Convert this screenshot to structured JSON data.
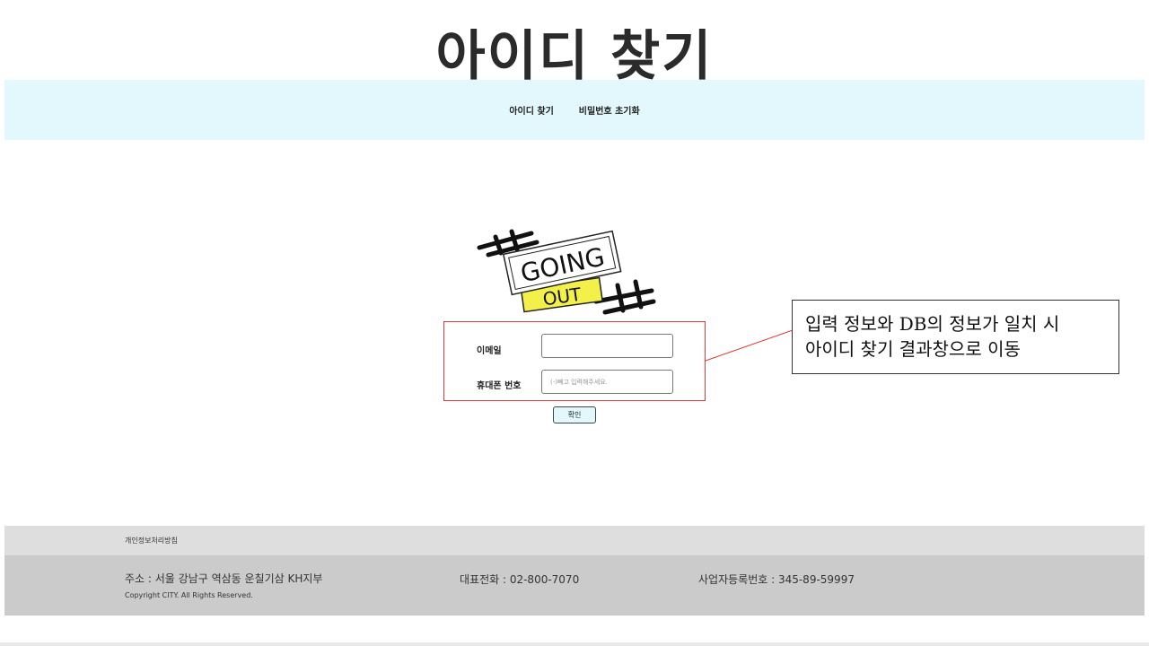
{
  "page": {
    "title": "아이디 찾기"
  },
  "nav": {
    "items": [
      {
        "label": "아이디 찾기"
      },
      {
        "label": "비밀번호 초기화"
      }
    ]
  },
  "logo": {
    "line1": "GOING",
    "line2": "OUT"
  },
  "form": {
    "email_label": "이메일",
    "email_value": "",
    "phone_label": "휴대폰 번호",
    "phone_placeholder": "(-)빼고 입력해주세요.",
    "confirm_label": "확인"
  },
  "callout": {
    "line1": "입력 정보와 DB의 정보가 일치 시",
    "line2": "아이디 찾기 결과창으로 이동"
  },
  "footer": {
    "privacy": "개인정보처리방침",
    "address": "주소 : 서울 강남구 역삼동 운칠기삼 KH지부",
    "phone": "대표전화 : 02-800-7070",
    "business_no": "사업자등록번호 : 345-89-59997",
    "copyright": "Copyright CITY. All Rights Reserved."
  },
  "colors": {
    "nav_bg": "#e2f8fc",
    "highlight_border": "#e03a3a",
    "logo_yellow": "#f4f04a",
    "footer_top": "#dedede",
    "footer_bottom": "#cbcbcb"
  }
}
